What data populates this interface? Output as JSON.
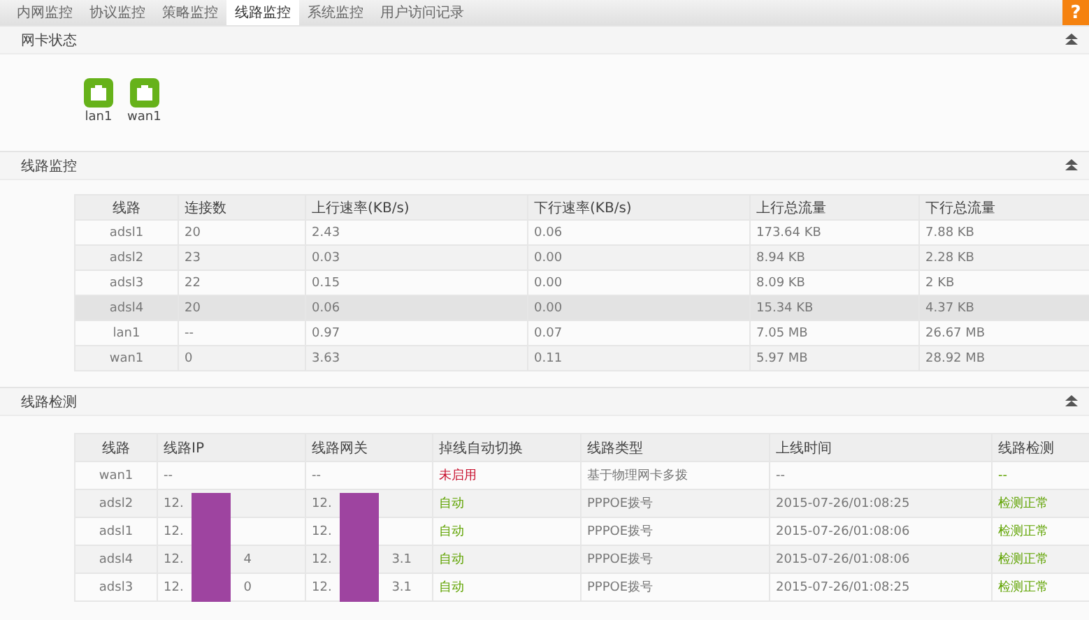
{
  "tabs": [
    {
      "label": "内网监控",
      "selected": false
    },
    {
      "label": "协议监控",
      "selected": false
    },
    {
      "label": "策略监控",
      "selected": false
    },
    {
      "label": "线路监控",
      "selected": true
    },
    {
      "label": "系统监控",
      "selected": false
    },
    {
      "label": "用户访问记录",
      "selected": false
    }
  ],
  "help": {
    "label": "?"
  },
  "nic_status": {
    "title": "网卡状态",
    "ports": [
      {
        "label": "lan1"
      },
      {
        "label": "wan1"
      }
    ]
  },
  "line_monitor": {
    "title": "线路监控",
    "columns": [
      "线路",
      "连接数",
      "上行速率(KB/s)",
      "下行速率(KB/s)",
      "上行总流量",
      "下行总流量"
    ],
    "rows": [
      {
        "cells": [
          "adsl1",
          "20",
          "2.43",
          "0.06",
          "173.64 KB",
          "7.88 KB"
        ],
        "highlighted": false
      },
      {
        "cells": [
          "adsl2",
          "23",
          "0.03",
          "0.00",
          "8.94 KB",
          "2.28 KB"
        ],
        "highlighted": false
      },
      {
        "cells": [
          "adsl3",
          "22",
          "0.15",
          "0.00",
          "8.09 KB",
          "2 KB"
        ],
        "highlighted": false
      },
      {
        "cells": [
          "adsl4",
          "20",
          "0.06",
          "0.00",
          "15.34 KB",
          "4.37 KB"
        ],
        "highlighted": true
      },
      {
        "cells": [
          "lan1",
          "--",
          "0.97",
          "0.07",
          "7.05 MB",
          "26.67 MB"
        ],
        "highlighted": false
      },
      {
        "cells": [
          "wan1",
          "0",
          "3.63",
          "0.11",
          "5.97 MB",
          "28.92 MB"
        ],
        "highlighted": false
      }
    ]
  },
  "line_check": {
    "title": "线路检测",
    "columns": [
      "线路",
      "线路IP",
      "线路网关",
      "掉线自动切换",
      "线路类型",
      "上线时间",
      "线路检测"
    ],
    "rows": [
      {
        "line": "wan1",
        "ip": {
          "start": "--",
          "redacted": false
        },
        "gateway": {
          "start": "--",
          "redacted": false
        },
        "switch": {
          "text": "未启用",
          "enabled": false
        },
        "type": "基于物理网卡多拨",
        "time": "--",
        "check": {
          "text": "--",
          "normal": true
        }
      },
      {
        "line": "adsl2",
        "ip": {
          "start": "12.",
          "redacted": true
        },
        "gateway": {
          "start": "12.",
          "redacted": true
        },
        "switch": {
          "text": "自动",
          "enabled": true
        },
        "type": "PPPOE拨号",
        "time": "2015-07-26/01:08:25",
        "check": {
          "text": "检测正常",
          "normal": true
        }
      },
      {
        "line": "adsl1",
        "ip": {
          "start": "12.",
          "redacted": true
        },
        "gateway": {
          "start": "12.",
          "redacted": true
        },
        "switch": {
          "text": "自动",
          "enabled": true
        },
        "type": "PPPOE拨号",
        "time": "2015-07-26/01:08:06",
        "check": {
          "text": "检测正常",
          "normal": true
        }
      },
      {
        "line": "adsl4",
        "ip": {
          "start": "12.",
          "end": "4",
          "redacted": true
        },
        "gateway": {
          "start": "12.",
          "end": "3.1",
          "redacted": true
        },
        "switch": {
          "text": "自动",
          "enabled": true
        },
        "type": "PPPOE拨号",
        "time": "2015-07-26/01:08:06",
        "check": {
          "text": "检测正常",
          "normal": true
        }
      },
      {
        "line": "adsl3",
        "ip": {
          "start": "12.",
          "end": "0",
          "redacted": true
        },
        "gateway": {
          "start": "12.",
          "end": "3.1",
          "redacted": true
        },
        "switch": {
          "text": "自动",
          "enabled": true
        },
        "type": "PPPOE拨号",
        "time": "2015-07-26/01:08:25",
        "check": {
          "text": "检测正常",
          "normal": true
        }
      }
    ]
  }
}
